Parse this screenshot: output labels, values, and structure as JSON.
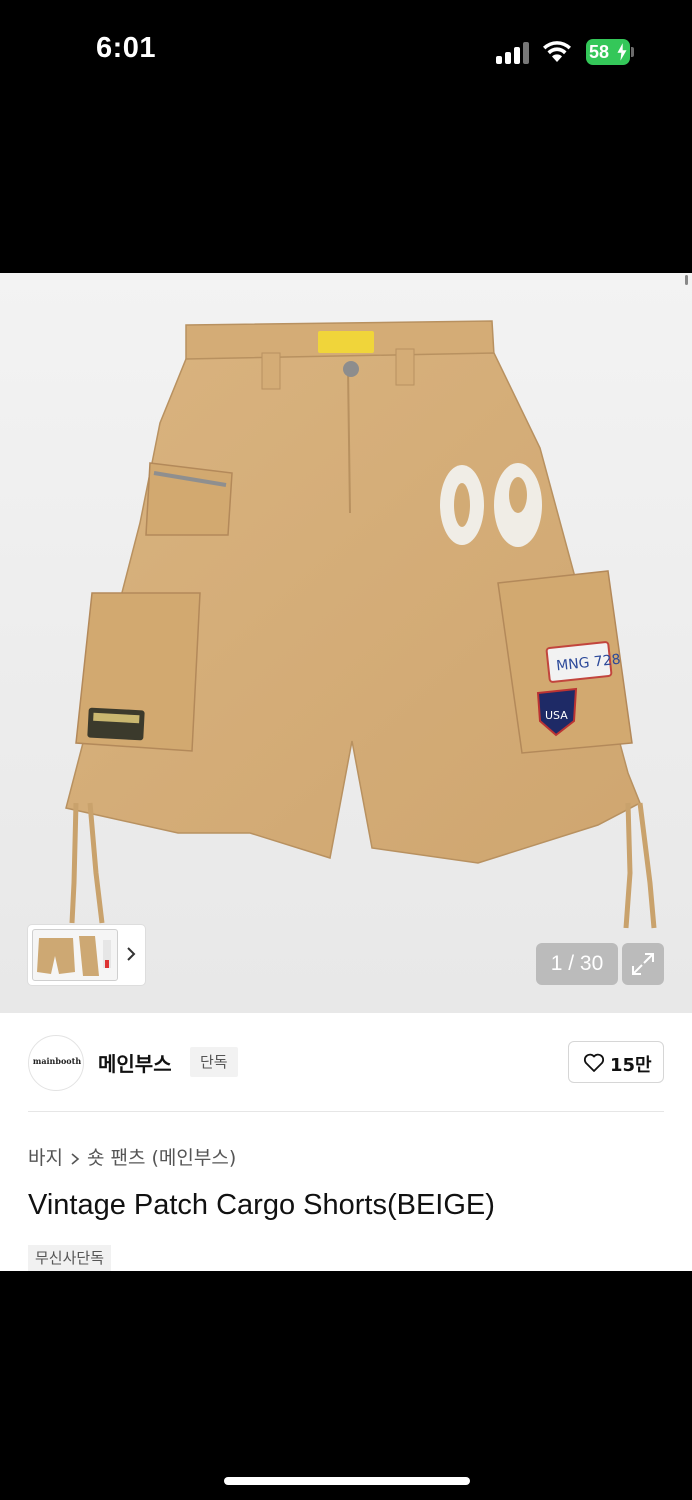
{
  "status_bar": {
    "time": "6:01",
    "battery": "58"
  },
  "gallery": {
    "counter": "1 / 30",
    "thumbnail_label": "product-thumbnail"
  },
  "brand": {
    "logo_text": "mainbooth",
    "name": "메인부스",
    "tag": "단독",
    "like_count": "15만"
  },
  "breadcrumb": {
    "level1": "바지",
    "level2": "숏 팬츠 (메인부스)"
  },
  "product": {
    "title": "Vintage Patch Cargo Shorts(BEIGE)",
    "badge": "무신사단독"
  },
  "colors": {
    "accent_battery": "#34c759",
    "shorts": "#d8b27e"
  }
}
